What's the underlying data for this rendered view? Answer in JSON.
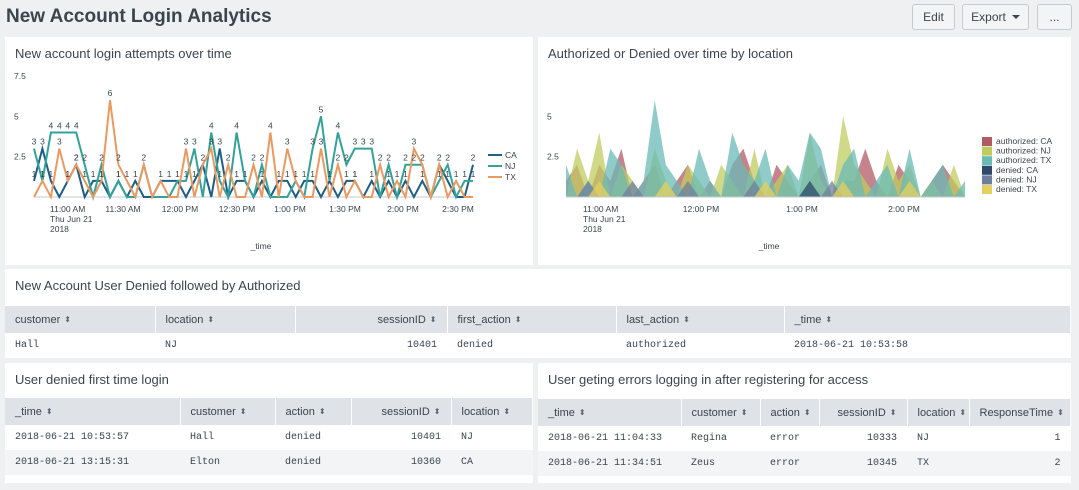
{
  "dashboard": {
    "title": "New Account Login Analytics",
    "edit_label": "Edit",
    "export_label": "Export",
    "more_label": "..."
  },
  "panels": {
    "attempts": {
      "title": "New account login attempts over time"
    },
    "authorized": {
      "title": "Authorized or Denied over time by location"
    },
    "denied_then_auth": {
      "title": "New Account User Denied followed by Authorized",
      "columns": [
        "customer",
        "location",
        "sessionID",
        "first_action",
        "last_action",
        "_time"
      ],
      "rows": [
        [
          "Hall",
          "NJ",
          "10401",
          "denied",
          "authorized",
          "2018-06-21 10:53:58"
        ]
      ]
    },
    "denied_first": {
      "title": "User denied first time login",
      "columns": [
        "_time",
        "customer",
        "action",
        "sessionID",
        "location"
      ],
      "rows": [
        [
          "2018-06-21 10:53:57",
          "Hall",
          "denied",
          "10401",
          "NJ"
        ],
        [
          "2018-06-21 13:15:31",
          "Elton",
          "denied",
          "10360",
          "CA"
        ]
      ]
    },
    "errors": {
      "title": "User geting errors logging in after registering for access",
      "columns": [
        "_time",
        "customer",
        "action",
        "sessionID",
        "location",
        "ResponseTime"
      ],
      "rows": [
        [
          "2018-06-21 11:04:33",
          "Regina",
          "error",
          "10333",
          "NJ",
          "1"
        ],
        [
          "2018-06-21 11:34:51",
          "Zeus",
          "error",
          "10345",
          "TX",
          "2"
        ]
      ]
    }
  },
  "chart_data": [
    {
      "type": "line",
      "title": "New account login attempts over time",
      "xlabel": "_time",
      "x_ticks": [
        "11:00 AM\nThu Jun 21\n2018",
        "11:30 AM",
        "12:00 PM",
        "12:30 PM",
        "1:00 PM",
        "1:30 PM",
        "2:00 PM",
        "2:30 PM"
      ],
      "y_ticks": [
        "2.5",
        "5",
        "7.5"
      ],
      "ylim": [
        0,
        7.5
      ],
      "legend_position": "right",
      "series": [
        {
          "name": "CA",
          "color": "#1e5f86",
          "values": [
            1,
            3,
            1,
            0,
            1,
            2,
            0,
            1,
            1,
            0,
            1,
            0,
            1,
            0,
            0,
            1,
            1,
            1,
            0,
            1,
            2,
            0,
            3,
            0,
            1,
            1,
            0,
            1,
            0,
            1,
            1,
            0,
            1,
            1,
            0,
            1,
            0,
            1,
            1,
            0,
            1,
            0,
            1,
            0,
            1,
            0,
            1,
            0,
            2,
            1,
            0,
            0,
            2
          ]
        },
        {
          "name": "NJ",
          "color": "#31a398",
          "values": [
            3,
            1,
            4,
            4,
            4,
            4,
            2,
            0,
            2,
            0,
            1,
            0,
            0,
            2,
            0,
            0,
            0,
            1,
            1,
            3,
            0,
            4,
            1,
            0,
            4,
            1,
            0,
            2,
            0,
            0,
            0,
            1,
            0,
            3,
            5,
            1,
            4,
            2,
            3,
            3,
            3,
            0,
            2,
            0,
            2,
            2,
            2,
            0,
            1,
            2,
            0,
            1,
            1
          ]
        },
        {
          "name": "TX",
          "color": "#ec9960",
          "values": [
            0,
            1,
            0,
            3,
            1,
            2,
            1,
            0,
            1,
            6,
            2,
            1,
            0,
            2,
            0,
            1,
            0,
            0,
            3,
            0,
            2,
            3,
            0,
            2,
            0,
            0,
            2,
            0,
            4,
            0,
            3,
            1,
            0,
            0,
            3,
            0,
            2,
            0,
            1,
            0,
            0,
            2,
            0,
            1,
            0,
            3,
            2,
            0,
            2,
            0,
            1,
            0,
            0
          ]
        }
      ]
    },
    {
      "type": "area",
      "title": "Authorized or Denied over time by location",
      "xlabel": "_time",
      "x_ticks": [
        "11:00 AM\nThu Jun 21\n2018",
        "12:00 PM",
        "1:00 PM",
        "2:00 PM"
      ],
      "y_ticks": [
        "2.5",
        "5"
      ],
      "legend_position": "right",
      "series": [
        {
          "name": "authorized: CA",
          "color": "#b15b64"
        },
        {
          "name": "authorized: NJ",
          "color": "#c0cc5f"
        },
        {
          "name": "authorized: TX",
          "color": "#6abab5"
        },
        {
          "name": "denied: CA",
          "color": "#2c4a6b"
        },
        {
          "name": "denied: NJ",
          "color": "#6f7f9b"
        },
        {
          "name": "denied: TX",
          "color": "#e6d05f"
        }
      ]
    }
  ]
}
